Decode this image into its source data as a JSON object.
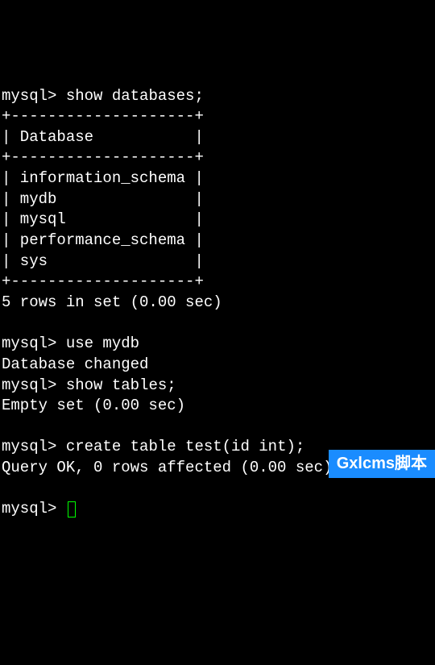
{
  "prompt": "mysql>",
  "cmd1": "show databases;",
  "border_top": "+--------------------+",
  "header_row": "| Database           |",
  "border_mid": "+--------------------+",
  "rows": [
    "| information_schema |",
    "| mydb               |",
    "| mysql              |",
    "| performance_schema |",
    "| sys                |"
  ],
  "border_bot": "+--------------------+",
  "result1": "5 rows in set (0.00 sec)",
  "cmd2": "use mydb",
  "msg2": "Database changed",
  "cmd3": "show tables;",
  "result3": "Empty set (0.00 sec)",
  "cmd4": "create table test(id int);",
  "result4": "Query OK, 0 rows affected (0.00 sec)",
  "watermark": "Gxlcms脚本"
}
